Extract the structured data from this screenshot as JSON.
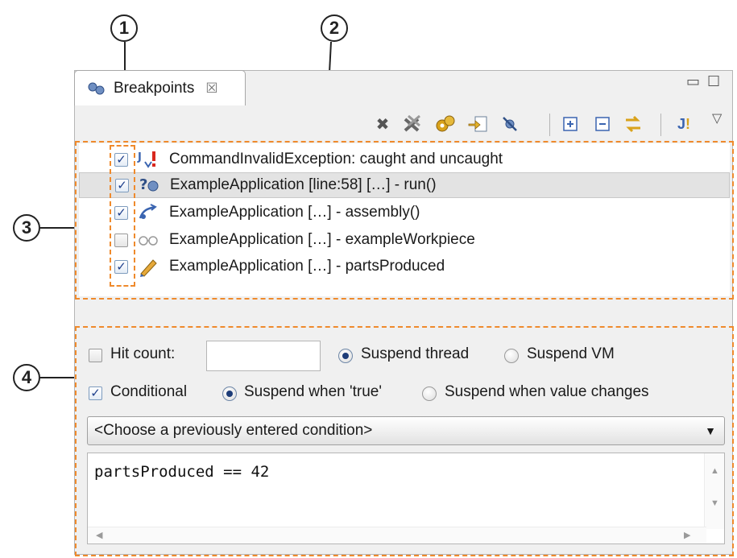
{
  "callouts": [
    "1",
    "2",
    "3",
    "4"
  ],
  "view": {
    "tab_title": "Breakpoints",
    "tab_close": "☒",
    "minimize": "▭",
    "maximize": "☐",
    "view_menu": "▽"
  },
  "toolbar": {
    "icons": [
      "remove-selected-icon",
      "remove-all-icon",
      "show-supported-breakpoints-icon",
      "go-to-file-icon",
      "skip-all-breakpoints-icon",
      "expand-all-icon",
      "collapse-all-icon",
      "link-with-debug-view-icon",
      "add-java-exception-breakpoint-icon"
    ],
    "colors": {
      "remove": "#555555",
      "gold": "#d9a21b",
      "blue": "#3a64b0",
      "green": "#3b8c3b"
    }
  },
  "breakpoints": [
    {
      "label": "CommandInvalidException: caught and uncaught",
      "checked": true,
      "icon": "exception-breakpoint-icon",
      "selected": false
    },
    {
      "label": "ExampleApplication [line:58] […] - run()",
      "checked": true,
      "icon": "line-breakpoint-icon",
      "selected": true
    },
    {
      "label": "ExampleApplication […] - assembly()",
      "checked": true,
      "icon": "method-breakpoint-icon",
      "selected": false
    },
    {
      "label": "ExampleApplication […] - exampleWorkpiece",
      "checked": false,
      "icon": "watchpoint-icon",
      "selected": false
    },
    {
      "label": "ExampleApplication […] - partsProduced",
      "checked": true,
      "icon": "modification-watchpoint-icon",
      "selected": false
    }
  ],
  "detail": {
    "hit_count_label": "Hit count:",
    "hit_count_value": "",
    "hit_count_checked": false,
    "suspend_thread_label": "Suspend thread",
    "suspend_vm_label": "Suspend VM",
    "suspend_policy": "thread",
    "conditional_label": "Conditional",
    "conditional_checked": true,
    "suspend_true_label": "Suspend when 'true'",
    "suspend_changes_label": "Suspend when value changes",
    "condition_mode": "true",
    "condition_combo": "<Choose a previously entered condition>",
    "condition_code": "partsProduced == 42"
  },
  "colors": {
    "highlight_dash": "#ef8a2c",
    "check_mark": "#1e3f8c",
    "selected_row": "#e3e3e3"
  }
}
